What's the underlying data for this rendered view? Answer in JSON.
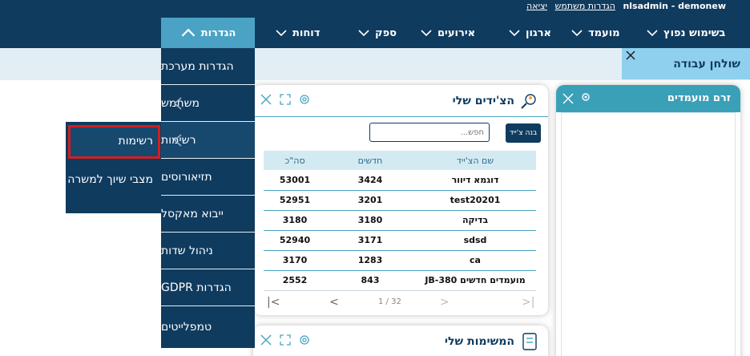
{
  "header": {
    "username": "nlsadmin - demonew",
    "user_settings_link": "הגדרות משתמש",
    "logout_link": "יציאה"
  },
  "nav": {
    "items": [
      {
        "label": "בשימוש נפוץ"
      },
      {
        "label": "מועמד"
      },
      {
        "label": "ארגון"
      },
      {
        "label": "אירועים"
      },
      {
        "label": "ספק"
      },
      {
        "label": "דוחות"
      },
      {
        "label": "הגדרות"
      }
    ]
  },
  "workspace_tab": {
    "label": "שולחן עבודה"
  },
  "candidate_stream": {
    "title": "זרם מועמדים"
  },
  "tools_panel": {
    "title": "הצ'ידים שלי",
    "search_placeholder": "חפש...",
    "build_button": "בנה צ'ייד",
    "columns": {
      "name": "שם הצ'ייד",
      "new": "חדשים",
      "total": "סה\"כ"
    },
    "rows": [
      {
        "name": "דוגמא דיוור",
        "new": "3424",
        "total": "53001"
      },
      {
        "name": "test20201",
        "new": "3201",
        "total": "52951"
      },
      {
        "name": "בדיקה",
        "new": "3180",
        "total": "3180"
      },
      {
        "name": "sdsd",
        "new": "3171",
        "total": "52940"
      },
      {
        "name": "ca",
        "new": "1283",
        "total": "3170"
      },
      {
        "name": "מועמדים חדשים JB-380",
        "new": "843",
        "total": "2552"
      }
    ],
    "pager": "1 / 32"
  },
  "tasks_panel": {
    "title": "המשימות שלי"
  },
  "settings_menu": {
    "items": [
      {
        "label": "הגדרות מערכת"
      },
      {
        "label": "משתמש"
      },
      {
        "label": "רשימות"
      },
      {
        "label": "תזיאורוסים"
      },
      {
        "label": "ייבוא מאקסל"
      },
      {
        "label": "ניהול שדות"
      },
      {
        "label": "הגדרות GDPR"
      },
      {
        "label": "טמפלייטים"
      }
    ]
  },
  "lists_submenu": {
    "items": [
      {
        "label": "רשימות"
      },
      {
        "label": "מצבי שיוך למשרה"
      }
    ]
  },
  "colors": {
    "primary": "#0f3b5f",
    "accent": "#4aa3c4",
    "highlight": "#d21f1f"
  }
}
